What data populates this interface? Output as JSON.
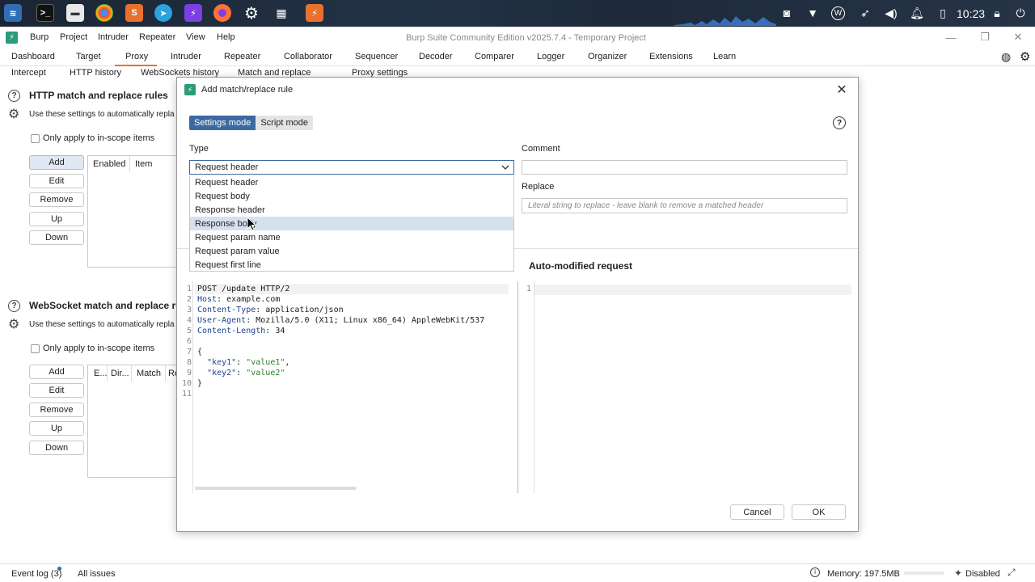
{
  "taskbar": {
    "clock": "10:23"
  },
  "app": {
    "window_title": "Burp Suite Community Edition v2025.7.4 - Temporary Project",
    "menu": [
      "Burp",
      "Project",
      "Intruder",
      "Repeater",
      "View",
      "Help"
    ]
  },
  "main_tabs": [
    "Dashboard",
    "Target",
    "Proxy",
    "Intruder",
    "Repeater",
    "Collaborator",
    "Sequencer",
    "Decoder",
    "Comparer",
    "Logger",
    "Organizer",
    "Extensions",
    "Learn"
  ],
  "active_main_tab": "Proxy",
  "sub_tabs": [
    "Intercept",
    "HTTP history",
    "WebSockets history",
    "Match and replace",
    "Proxy settings"
  ],
  "http_section": {
    "title": "HTTP match and replace rules",
    "description": "Use these settings to automatically repla",
    "scope_label": "Only apply to in-scope items",
    "buttons": [
      "Add",
      "Edit",
      "Remove",
      "Up",
      "Down"
    ],
    "columns": [
      "Enabled",
      "Item"
    ]
  },
  "ws_section": {
    "title": "WebSocket match and replace ru",
    "description": "Use these settings to automatically repla",
    "scope_label": "Only apply to in-scope items",
    "buttons": [
      "Add",
      "Edit",
      "Remove",
      "Up",
      "Down"
    ],
    "columns": [
      "E...",
      "Dir...",
      "Match",
      "Re"
    ]
  },
  "dialog": {
    "title": "Add match/replace rule",
    "mode_settings": "Settings mode",
    "mode_script": "Script mode",
    "type_label": "Type",
    "type_value": "Request header",
    "type_options": [
      "Request header",
      "Request body",
      "Response header",
      "Response body",
      "Request param name",
      "Request param value",
      "Request first line"
    ],
    "hovered_option": "Response body",
    "comment_label": "Comment",
    "comment_value": "",
    "replace_label": "Replace",
    "replace_placeholder": "Literal string to replace - leave blank to remove a matched header",
    "auto_modified_title": "Auto-modified request",
    "cancel": "Cancel",
    "ok": "OK"
  },
  "request_lines": [
    "POST /update HTTP/2",
    "Host: example.com",
    "Content-Type: application/json",
    "User-Agent: Mozilla/5.0 (X11; Linux x86_64) AppleWebKit/537",
    "Content-Length: 34",
    "",
    "{",
    "  \"key1\": \"value1\",",
    "  \"key2\": \"value2\"",
    "}",
    ""
  ],
  "right_line_numbers": [
    "1"
  ],
  "statusbar": {
    "event_log": "Event log (3)",
    "all_issues": "All issues",
    "memory": "Memory: 197.5MB",
    "disabled": "Disabled"
  }
}
